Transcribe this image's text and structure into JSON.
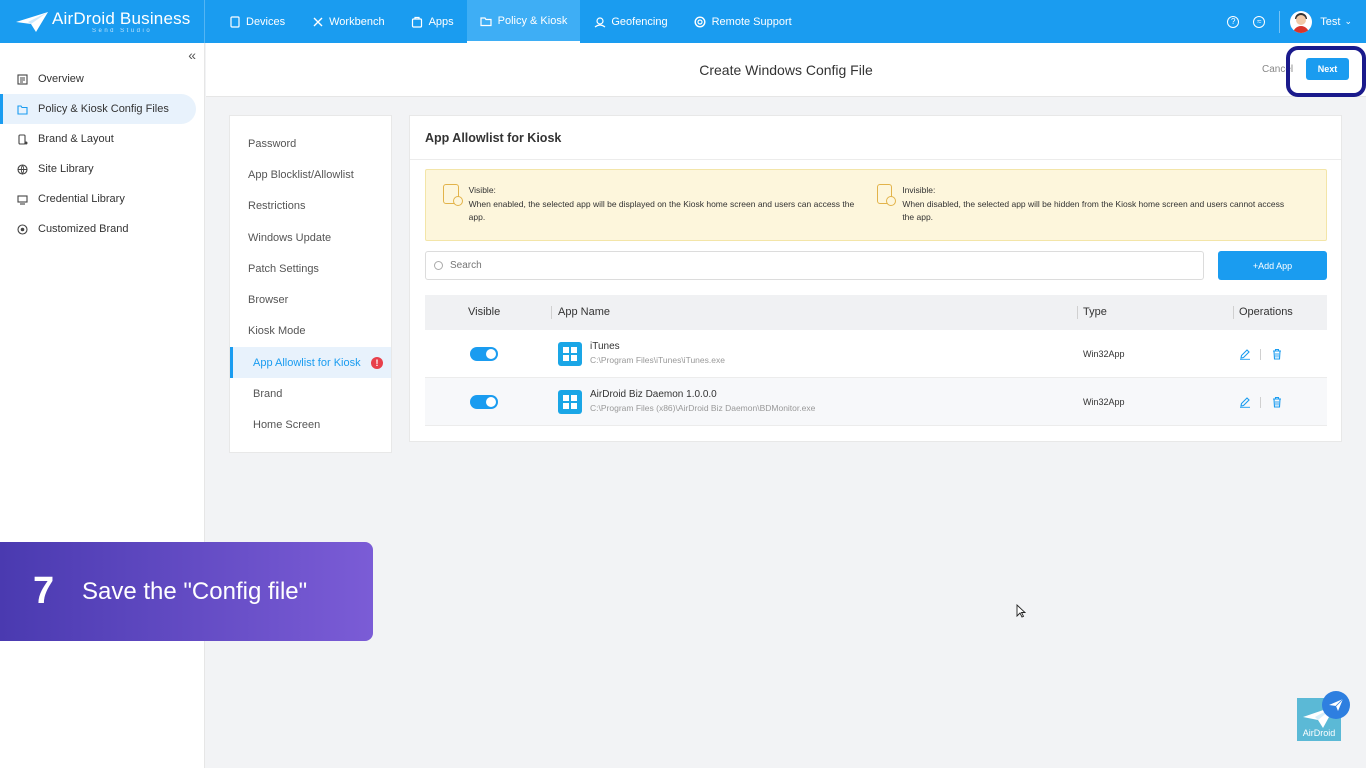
{
  "brand": {
    "name": "AirDroid Business",
    "sub": "Send Studio"
  },
  "nav": [
    {
      "label": "Devices",
      "icon": "devices-icon"
    },
    {
      "label": "Workbench",
      "icon": "workbench-icon"
    },
    {
      "label": "Apps",
      "icon": "apps-icon"
    },
    {
      "label": "Policy & Kiosk",
      "icon": "policy-icon",
      "active": true
    },
    {
      "label": "Geofencing",
      "icon": "geofencing-icon"
    },
    {
      "label": "Remote Support",
      "icon": "remote-support-icon"
    }
  ],
  "user": {
    "name": "Test"
  },
  "sidebar": {
    "items": [
      {
        "label": "Overview",
        "icon": "overview-icon"
      },
      {
        "label": "Policy & Kiosk Config Files",
        "icon": "config-files-icon",
        "active": true
      },
      {
        "label": "Brand & Layout",
        "icon": "brand-layout-icon"
      },
      {
        "label": "Site Library",
        "icon": "site-library-icon"
      },
      {
        "label": "Credential Library",
        "icon": "credential-library-icon"
      },
      {
        "label": "Customized Brand",
        "icon": "customized-brand-icon"
      }
    ]
  },
  "header": {
    "title": "Create Windows Config File",
    "cancel_label": "Cancel",
    "next_label": "Next"
  },
  "config_menu": {
    "items": [
      {
        "label": "Password"
      },
      {
        "label": "App Blocklist/Allowlist"
      },
      {
        "label": "Restrictions"
      },
      {
        "label": "Windows Update"
      },
      {
        "label": "Patch Settings"
      },
      {
        "label": "Browser"
      },
      {
        "label": "Kiosk Mode"
      },
      {
        "label": "App Allowlist for Kiosk",
        "active": true,
        "sub": true,
        "error": "!"
      },
      {
        "label": "Brand",
        "sub": true
      },
      {
        "label": "Home Screen",
        "sub": true
      }
    ]
  },
  "panel": {
    "title": "App Allowlist for Kiosk",
    "notice_visible": {
      "heading": "Visible:",
      "text": "When enabled, the selected app will be displayed on the Kiosk home screen and users can access the app."
    },
    "notice_invisible": {
      "heading": "Invisible:",
      "text": "When disabled, the selected app will be hidden from the Kiosk home screen and users cannot access the app."
    },
    "search_placeholder": "Search",
    "add_label": "+Add App",
    "columns": [
      "Visible",
      "App Name",
      "Type",
      "Operations"
    ],
    "rows": [
      {
        "visible": true,
        "name": "iTunes",
        "path": "C:\\Program Files\\iTunes\\iTunes.exe",
        "type": "Win32App"
      },
      {
        "visible": true,
        "name": "AirDroid Biz Daemon 1.0.0.0",
        "path": "C:\\Program Files (x86)\\AirDroid Biz Daemon\\BDMonitor.exe",
        "type": "Win32App"
      }
    ]
  },
  "step": {
    "number": "7",
    "text": "Save the \"Config file\""
  },
  "widget": {
    "label": "AirDroid"
  },
  "colors": {
    "primary": "#1a9cf0",
    "banner_start": "#4a3ab0",
    "banner_end": "#7b5cd6",
    "notice_bg": "#fdf6dc",
    "highlight": "#1a1a8c"
  }
}
